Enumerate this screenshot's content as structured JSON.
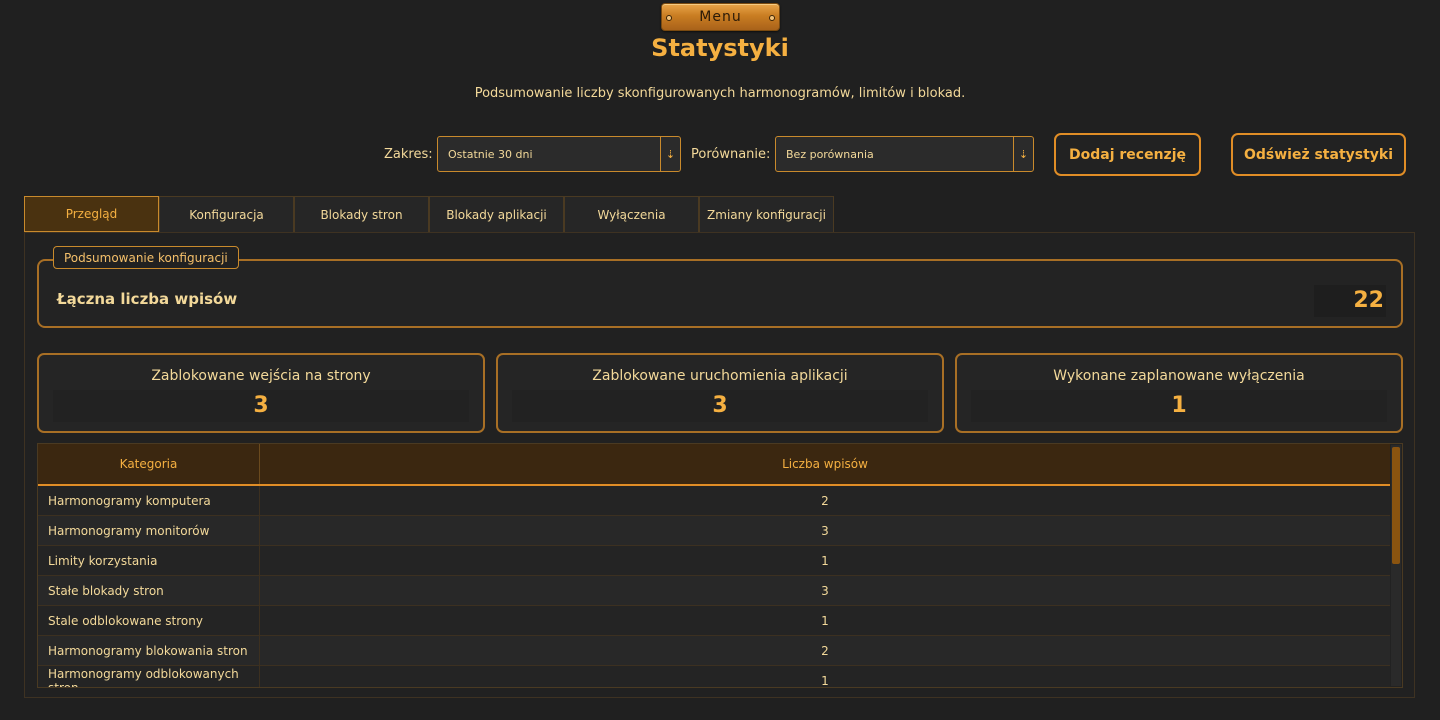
{
  "menu": {
    "label": "Menu"
  },
  "header": {
    "title": "Statystyki",
    "subtitle": "Podsumowanie liczby skonfigurowanych harmonogramów, limitów i blokad."
  },
  "filters": {
    "range_label": "Zakres:",
    "range_value": "Ostatnie 30 dni",
    "compare_label": "Porównanie:",
    "compare_value": "Bez porównania",
    "dropdown_arrow": "⇣"
  },
  "actions": {
    "add_review": "Dodaj recenzję",
    "refresh": "Odśwież statystyki"
  },
  "tabs": [
    {
      "label": "Przegląd",
      "active": true
    },
    {
      "label": "Konfiguracja"
    },
    {
      "label": "Blokady stron"
    },
    {
      "label": "Blokady aplikacji"
    },
    {
      "label": "Wyłączenia"
    },
    {
      "label": "Zmiany konfiguracji"
    }
  ],
  "summary": {
    "legend": "Podsumowanie konfiguracji",
    "total_label": "Łączna liczba wpisów",
    "total_value": "22"
  },
  "stats": [
    {
      "title": "Zablokowane wejścia na strony",
      "value": "3"
    },
    {
      "title": "Zablokowane uruchomienia aplikacji",
      "value": "3"
    },
    {
      "title": "Wykonane zaplanowane wyłączenia",
      "value": "1"
    }
  ],
  "table": {
    "headers": [
      "Kategoria",
      "Liczba wpisów"
    ],
    "rows": [
      [
        "Harmonogramy komputera",
        "2"
      ],
      [
        "Harmonogramy monitorów",
        "3"
      ],
      [
        "Limity korzystania",
        "1"
      ],
      [
        "Stałe blokady stron",
        "3"
      ],
      [
        "Stale odblokowane strony",
        "1"
      ],
      [
        "Harmonogramy blokowania stron",
        "2"
      ],
      [
        "Harmonogramy odblokowanych stron",
        "1"
      ]
    ]
  },
  "colors": {
    "accent": "#f5b041",
    "border": "#c98a2c",
    "background": "#202020",
    "text": "#f3d99a"
  }
}
